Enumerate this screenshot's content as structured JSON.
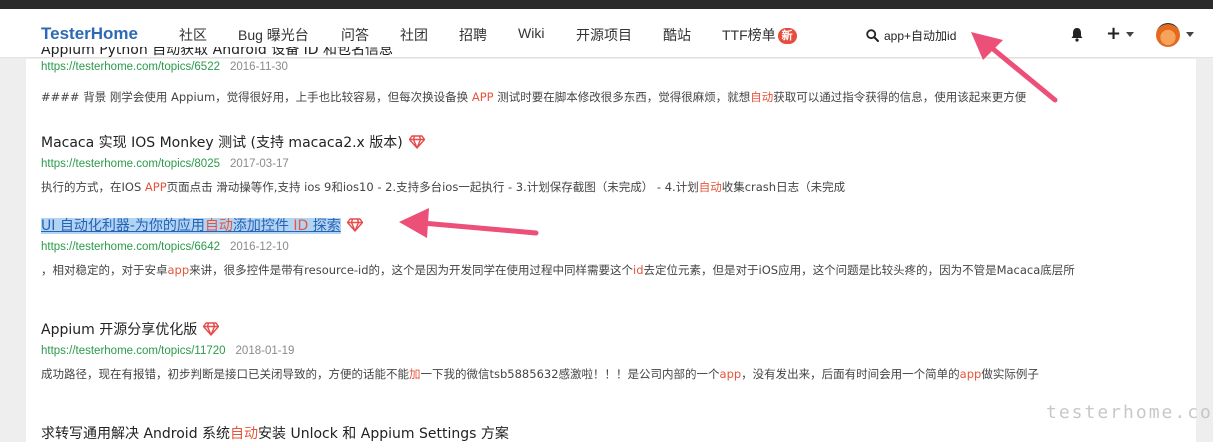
{
  "nav": {
    "brand": "TesterHome",
    "items": [
      "社区",
      "Bug 曝光台",
      "问答",
      "社团",
      "招聘",
      "Wiki",
      "开源项目",
      "酷站",
      "TTF榜单"
    ],
    "new_badge": "新",
    "search_value": "app+自动加id"
  },
  "results": [
    {
      "title_visible": "Appium Python 自动获取 Android 设备 ID 和包名信息",
      "url": "https://testerhome.com/topics/6522",
      "date": "2016-11-30",
      "snippet": [
        "#### 背景 刚学会使用 Appium，觉得很好用，上手也比较容易，但每次换设备换 ",
        "APP",
        " 测试时要在脚本修改很多东西，觉得很麻烦，就想",
        "自动",
        "获取可以通过指令获得的信息，使用该起来更方便"
      ]
    },
    {
      "title": "Macaca 实现 IOS Monkey 测试 (支持 macaca2.x 版本)",
      "url": "https://testerhome.com/topics/8025",
      "date": "2017-03-17",
      "snippet": [
        "执行的方式，在IOS ",
        "APP",
        "页面点击 滑动操等作,支持 ios 9和ios10 - 2.支持多台ios一起执行 - 3.计划保存截图（未完成） - 4.计划",
        "自动",
        "收集crash日志（未完成"
      ]
    },
    {
      "title": [
        "UI 自动化利器-为你的应用",
        "自动",
        "添加控件 ",
        "ID",
        " 探索"
      ],
      "url": "https://testerhome.com/topics/6642",
      "date": "2016-12-10",
      "snippet": [
        "，相对稳定的，对于安卓",
        "app",
        "来讲，很多控件是带有resource-id的，这个是因为开发同学在使用过程中同样需要这个",
        "id",
        "去定位元素，但是对于iOS应用，这个问题是比较头疼的，因为不管是Macaca底层所"
      ]
    },
    {
      "title": "Appium 开源分享优化版",
      "url": "https://testerhome.com/topics/11720",
      "date": "2018-01-19",
      "snippet": [
        "成功路径，现在有报错，初步判断是接口已关闭导致的，方便的话能不能",
        "加",
        "一下我的微信tsb5885632感激啦！！！是公司内部的一个",
        "app",
        "，没有发出来，后面有时间会用一个简单的",
        "app",
        "做实际例子"
      ]
    },
    {
      "title": [
        "求转写通用解决 Android 系统",
        "自动",
        "安装 Unlock 和 Appium Settings 方案"
      ]
    }
  ],
  "watermark": "testerhome.com",
  "colors": {
    "brand": "#2d6ab3",
    "highlight": "#e5553b",
    "url": "#2a9a4a",
    "gem": "#e64b4b",
    "arrow": "#ec4f78"
  }
}
